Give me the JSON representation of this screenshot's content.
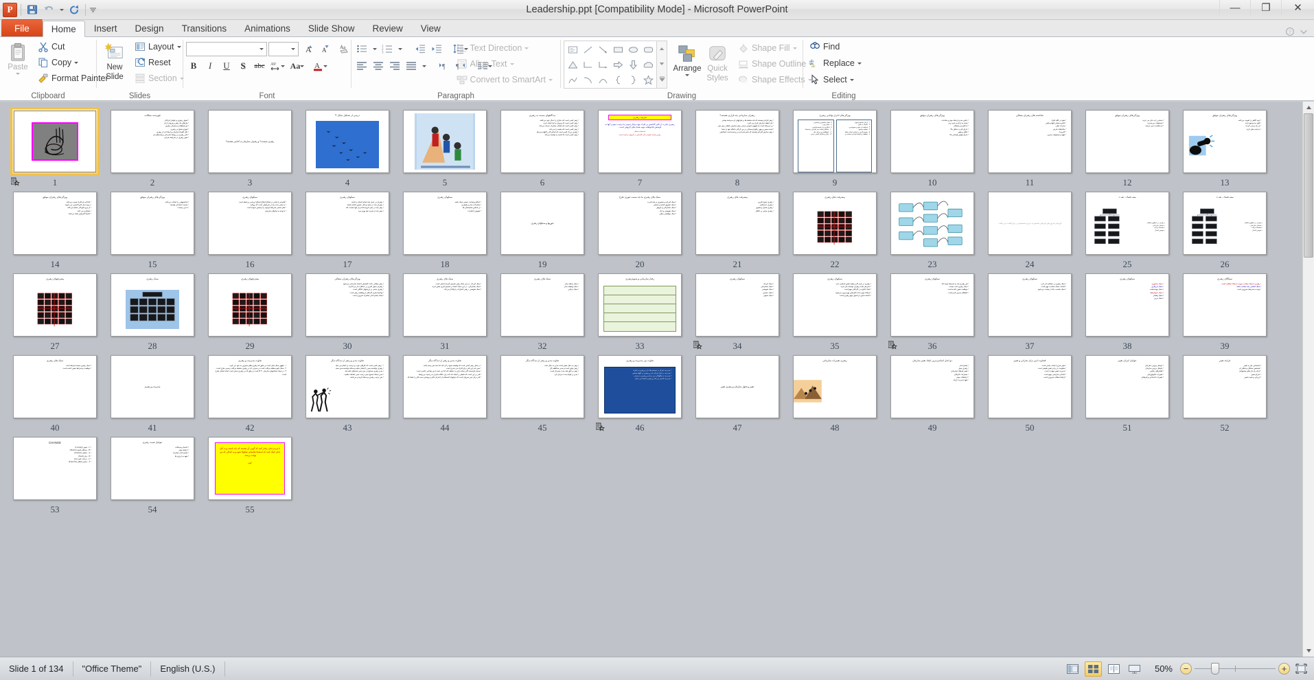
{
  "window": {
    "title": "Leadership.ppt [Compatibility Mode]  -  Microsoft PowerPoint",
    "minimize": "—",
    "restore": "❐",
    "close": "✕"
  },
  "qat": {
    "app_badge": "P",
    "items": [
      "save-icon",
      "undo-icon",
      "redo-icon",
      "customize-icon"
    ]
  },
  "tabs": [
    {
      "label": "File",
      "kind": "file"
    },
    {
      "label": "Home",
      "kind": "active"
    },
    {
      "label": "Insert",
      "kind": "normal"
    },
    {
      "label": "Design",
      "kind": "normal"
    },
    {
      "label": "Transitions",
      "kind": "normal"
    },
    {
      "label": "Animations",
      "kind": "normal"
    },
    {
      "label": "Slide Show",
      "kind": "normal"
    },
    {
      "label": "Review",
      "kind": "normal"
    },
    {
      "label": "View",
      "kind": "normal"
    }
  ],
  "ribbon": {
    "clipboard": {
      "label": "Clipboard",
      "paste": "Paste",
      "cut": "Cut",
      "copy": "Copy",
      "format_painter": "Format Painter"
    },
    "slides": {
      "label": "Slides",
      "new_slide": "New\nSlide",
      "new_slide_l1": "New",
      "new_slide_l2": "Slide",
      "layout": "Layout",
      "reset": "Reset",
      "section": "Section"
    },
    "font": {
      "label": "Font",
      "font_name": "",
      "font_size": "",
      "bold": "B",
      "italic": "I",
      "underline": "U",
      "shadow": "S",
      "strikethrough": "abc",
      "char_spacing": "AV",
      "change_case": "Aa",
      "font_color": "A",
      "grow_font": "A",
      "shrink_font": "A",
      "clear_formatting": "Aa"
    },
    "paragraph": {
      "label": "Paragraph",
      "text_direction": "Text Direction",
      "align_text": "Align Text",
      "convert_smartart": "Convert to SmartArt"
    },
    "drawing": {
      "label": "Drawing",
      "arrange": "Arrange",
      "quick_styles_l1": "Quick",
      "quick_styles_l2": "Styles",
      "shape_fill": "Shape Fill",
      "shape_outline": "Shape Outline",
      "shape_effects": "Shape Effects"
    },
    "editing": {
      "label": "Editing",
      "find": "Find",
      "replace": "Replace",
      "select": "Select"
    }
  },
  "status": {
    "slide_count": "Slide 1 of 134",
    "theme": "\"Office Theme\"",
    "language": "English (U.S.)",
    "zoom": "50%",
    "views": [
      {
        "name": "normal-view-button",
        "active": false
      },
      {
        "name": "slide-sorter-view-button",
        "active": true
      },
      {
        "name": "reading-view-button",
        "active": false
      },
      {
        "name": "slide-show-button",
        "active": false
      }
    ],
    "zoom_out": "−",
    "zoom_in": "+"
  },
  "slides": [
    {
      "n": "1",
      "type": "image-art",
      "selected": true,
      "anim": true,
      "title": "",
      "body": []
    },
    {
      "n": "2",
      "type": "bullets",
      "title": "فهرست مطالب",
      "body": [
        "اصول رهبری و عوامل اثرگذار",
        "نیازهای یک رهبر و پیروان از او",
        "تیم هماهنگ و سازمان رهبری",
        "بلوغ و تشنج در رهبری",
        "علل اقصاء سازمان و ارتقاء آن از رهبری",
        "تاثیر رهبری بر روابط سازمانی و پیامدهای آن",
        "تغییر رهبری در شرایط بحرانی"
      ]
    },
    {
      "n": "3",
      "type": "center",
      "title": "",
      "center": "رهبری چیست؟ و رهبران سازمان به کدامی هستند؟"
    },
    {
      "n": "4",
      "type": "image-birds",
      "title": "درسی از تشکیل شکل V",
      "body": []
    },
    {
      "n": "5",
      "type": "image-people",
      "title": "",
      "body": []
    },
    {
      "n": "6",
      "type": "bullets",
      "title": "دیدگاههای نسبت به رهبری",
      "body": [
        "رهبر کسی است که دیگران را دنبال خود می‌کشد",
        "رهبر کسی است که پیروان به او اعتماد دارند",
        "رهبر کسی است که باهدف مشترک حرکت می‌کند",
        "رهبر کسی است که مقصد را می‌داند",
        "رهبری بزرگ کسی است که انجام کار را الهام می‌دهد",
        "رهبر کسی است که افراد را توانمند می‌کند"
      ]
    },
    {
      "n": "7",
      "type": "definition",
      "title": "تعریف رهبری",
      "blue": "رهبری عبارت از تأثیر گذاشتن بر افراد جهت وادار نمودن یا ترغیب نمودن آنها به کوشش فاخواهانه جهت هدف های گروهی است .",
      "red_title": "باید هدف مدنظر",
      "red": "رهبری فرآیند کوشدر تأثیر گذاشتن بر گروهی از افراد است"
    },
    {
      "n": "8",
      "type": "bullets",
      "title": "رهبران سازمانی چه قراری هستند؟",
      "body": [
        "رهبر افرادی هستند که باید سلطه ها بر طرفهای آن سرشته پیشتر",
        "نیاز انعقاد سازمان قرار می گیرد .",
        "بر سرینکه است ما مفهوم عمومی آزسی رهبر سازش بامعادر زش نفی",
        "شده سپس و پنهن رافع آزسبجانی بر بین کركثر جایگاه عهد را بیاما",
        "رهبر سازش افرادی هستند که بایتر شده ای بر رسیده است اینجاتش"
      ]
    },
    {
      "n": "9",
      "type": "two-col",
      "title": "ویژگی‌های احراز توانایی رهبری",
      "col_right": [
        "۱ . آرمان صحیح و قوی :",
        "۲ . اعتماد به نفس :",
        "۳ . استفاده از نفوذ و حمونشری :",
        "۴ . تقطبید صحیح :",
        "۵ . تصمیم گیری بر اساس ایجاد رابطه",
        "۶ . تظاهیت و عامله افرادی سیاست و"
      ],
      "col_left": [
        "۷ . قصد تشخیص و پیشبینی :",
        "۸ . عمال بودن :",
        "۹ . ابتکاری و ارزشمندشناسی :",
        "۱۰ . نشاط و صمت سر افرادی پرشمشا :",
        "۱۱ . انعطافپذیری و بلند عیار",
        "۱۲ . شال و تشانلی کلشر برسی ."
      ]
    },
    {
      "n": "10",
      "type": "bullets",
      "title": "ویژگی‌های رهبران موفق",
      "body": [
        "دانش مند و ارتباط موثر و شناخت",
        "پایبند به اراده و عزم برتر",
        "با انگیزه و مشتاق",
        "دارای قدرت تحلیل بالا",
        "خلاق و نوآور",
        "دارای هوش هیجانی بالا"
      ]
    },
    {
      "n": "11",
      "type": "bullets",
      "title": "شاخصه های رهبران متعالی",
      "body": [
        "نفوذ در کلام افراد",
        "انگیزه بخشی الهام بخش",
        "محرک ذهنی",
        "ملاحظات فردی",
        "کاریزما",
        "تعهد و مسئولیت پذیری"
      ]
    },
    {
      "n": "12",
      "type": "bullets",
      "title": "ویژگی‌های رهبران موفق",
      "body": [
        "سختی را به جان می خرند",
        "مسئولیت می‌پذیرند",
        "از شکست نمی ترسند"
      ]
    },
    {
      "n": "13",
      "type": "image-binoc",
      "title": "ویژگی‌های رهبران موفق",
      "body": [
        "خود آگاهی را تقویت می‌کنند",
        "افق دید وسیع دارند",
        "از راه برنمی گردند",
        "به آینده نظر دارند"
      ]
    },
    {
      "n": "14",
      "type": "bullets",
      "title": "ویژگی‌های رهبران موفق",
      "body": [
        "عادلانه راه افراد نصیب می‌کنند",
        "زمینه ساز کاریا افزایی می شوند",
        "از نیرو مانع کار عملیه می‌کنند",
        "متفکری می کنند",
        "اعتماد افزایش ایجاد می‌کنند"
      ]
    },
    {
      "n": "15",
      "type": "bullets",
      "title": "ویژگی‌های رهبران موفق",
      "body": [
        "شاخصهایی را انتخاب می‌کنند",
        "محرك اجتماعی هستند",
        "با دین چیست"
      ]
    },
    {
      "n": "16",
      "type": "bullets",
      "title": "سبکهای رهبری",
      "body": [
        "قاصده را باشی در اصلاح اصلاح اصلاح ارزیابی و رابطه است",
        "به معنی بدنه راه در شرایطی است که رویکرد",
        "نظر سنجی شرایط موجود را آزمایش نموده است",
        "با توجه به نیازهای سازمان"
      ]
    },
    {
      "n": "17",
      "type": "bullets",
      "title": "سبکهای رهبری",
      "body": [
        "رهبران در عمل باید انجام اعمال را باشد",
        "رهبران باید در تمام مراحل حضور داشته باشند",
        "رهبر باید در میان گروه باشد و از آنها حمایت کند",
        "رهبر باید از تجربه خود بهره ببرد"
      ]
    },
    {
      "n": "18",
      "type": "bullets",
      "title": "سبکهای رهبری",
      "body": [
        "احکام و هدایت جمعی سبک باشد",
        "مشارکت مدار و همیاری",
        "بر اساس شایستگی ها",
        "تفویض اختیارات"
      ]
    },
    {
      "n": "19",
      "type": "center",
      "title": "",
      "center": "تئوریها و سبکهای رهبری"
    },
    {
      "n": "20",
      "type": "bullets",
      "title": "سبک های رهبری ما چه سمت تئوری طرح",
      "body": [
        "سبک آمرانه و دستوری بر پایه قدرت",
        "سبک تشویق کننده و حمایتی",
        "سبک مشارکتی و گروهی",
        "سبک تفویضی و آزاد",
        "سبک موقعیتی متغیر"
      ]
    },
    {
      "n": "21",
      "type": "bullets",
      "title": "پیشرفت های رهبری",
      "body": [
        "رهبری تحول آفرین",
        "رهبری خدمتگزار",
        "رهبری اصیل و معنوی",
        "رهبری مبتنی بر اخلاق"
      ]
    },
    {
      "n": "22",
      "type": "matrix-red",
      "title": "پیشرفت های رهبری",
      "body": []
    },
    {
      "n": "23",
      "type": "flow-diagram",
      "title": "",
      "body": []
    },
    {
      "n": "24",
      "type": "center-gray",
      "title": "",
      "center": "فروتنان امروز هم پذیرفتی تقسیم به عزیزه شستنیم در برابرگشت می باشد ."
    },
    {
      "n": "25",
      "type": "orgchart",
      "title": "پیشرفتهای رهبری",
      "body": []
    },
    {
      "n": "26",
      "type": "orgchart",
      "title": "پیشرفتهای رهبری",
      "body": []
    },
    {
      "n": "27",
      "type": "matrix-red2",
      "title": "پیشرفتهای رهبری",
      "body": []
    },
    {
      "n": "28",
      "type": "grid-dark",
      "title": "سبک رهبری",
      "body": []
    },
    {
      "n": "29",
      "type": "matrix-red3",
      "title": "پیشرفتهای رهبری",
      "body": []
    },
    {
      "n": "30",
      "type": "bullets",
      "title": "ویژگی‌های رهبران متعالی",
      "body": [
        "رهبر متعالی باعث افزایش اعتماد سازمانی می‌شود",
        "رهبران تحول آفرین بر عملکرد اثر می‌گذارند",
        "رهبری مبتنی بر ارزشهای اخلاقی است",
        "توانمندسازی کارکنان از وظایف رهبر است",
        "ایجاد چشم انداز مشترک ضروری است"
      ]
    },
    {
      "n": "31",
      "type": "bullets",
      "title": "سبک های رهبری",
      "body": [
        "سبک آمرانه ، در این سبک رهبر تصمیم گیرنده اصلی است",
        "سبک مشارکتی ، در این سبک اعضا در تصمیم گیری نقش دارند",
        "سبک تفویضی ، رهبر اختیارات را واگذار می‌کند"
      ]
    },
    {
      "n": "32",
      "type": "bullets",
      "title": "سبک های رهبری",
      "body": [
        "سبک رابطه مدار",
        "سبک وظیفه مدار",
        "سبک ترکیبی"
      ]
    },
    {
      "n": "33",
      "type": "green-table",
      "title": "رفتار سازمانی و شیوه‌رهبری",
      "body": []
    },
    {
      "n": "34",
      "type": "bullets",
      "anim": true,
      "title": "سبکهای رهبری",
      "body": [
        "سبک آمرانه",
        "سبک مشارکتی",
        "سبک تفویضی",
        "سبک حمایتی",
        "سبک تحولی"
      ]
    },
    {
      "n": "35",
      "type": "bullets",
      "title": "سبکهای رهبری",
      "body": [
        "رهبری در بازار کار و تولید نقش اساسی دارد",
        "سازمان ها به رهبران توانمند نیاز دارند",
        "ایجاد انگیزه در کارکنان مهم است",
        "ارتباط موثر باعث افزایش بهره وری می‌شود",
        "اعتماد سازی از اصول مهم رهبری است"
      ]
    },
    {
      "n": "36",
      "type": "bullets",
      "anim": true,
      "title": "سبکهای رهبری",
      "body": [
        "هر رهبری باید به شرایط توجه کند",
        "سبک رهبری ثابت نیست",
        "موقعیت تعیین کننده است",
        "انعطاف پذیری لازم است"
      ]
    },
    {
      "n": "37",
      "type": "bullets",
      "title": "سبکهای رهبری",
      "body": [
        "سبک رهبری بر عملکرد اثر دارد",
        "انتخاب سبک مناسب مهم است",
        "سبک مناسب باعث رضایت می‌شود"
      ]
    },
    {
      "n": "38",
      "type": "bullets-color",
      "title": "سبکهای رهبری",
      "body": [
        "سبک دستوری",
        "سبک مربیگری",
        "سبک پیونددهنده",
        "سبک دموکراتیک",
        "سبک پیشتاز",
        "سبک مربی"
      ]
    },
    {
      "n": "39",
      "type": "bullets-color",
      "title": "سبکگای رهبری",
      "body": [
        "رهبری با سبک مناسب موجب ارتقاء عملکرد است",
        "سبک انتخابی باید مناسب باشد",
        "توجه به شرایط ضروری است"
      ]
    },
    {
      "n": "40",
      "type": "bullets",
      "title": "سبک های رهبری",
      "body": [
        "سبک رهبری نتیجه شرایط است",
        "موقعیت و شرایط تعیین کننده است"
      ]
    },
    {
      "n": "41",
      "type": "center",
      "title": "",
      "center": "مدیریت و رهبری"
    },
    {
      "n": "42",
      "type": "bullets-num",
      "title": "تفاوت مدیریت و رهبری",
      "body": [
        "۱ . ظهور سبک مایل است بر طبق که رهبری ظلم محوری به خود می گیرد .",
        "۲ . سبک تاوم سلطه مراقب است در سیرتی که در رهبری سلطه مراقب رسمی طرح است .",
        "۳ . در سبک شعاعهای سازمان ۳۰ کا است بر طق که در رهبری سخن است اماته ایشان طرح است ."
      ]
    },
    {
      "n": "43",
      "type": "image-climb",
      "title": "تفاوت مدیر و رهبر از دیدگاه دیگر",
      "body": [
        "\" رهبر کسی است که کارهای خوب و درست را انجام می دهد و مدیر کسی است که کارها را به نحو انجام می دهد \"",
        "رهبری توانسته سیر را انتشار دهده و سبکه توانسته سیر صحیح را درست طی می‌کند",
        "مدیر رهبری صحیح در متن سیر دشدهای غلبه شد",
        "مدیر سبکه صحیح سیر درست سیر حفاظت طلبید .",
        "متن ترتیب رهبری و سبکه اثرپذیر می‌باشد"
      ]
    },
    {
      "n": "44",
      "type": "bullets",
      "title": "تفاوت مدیر و رهبر از دیدگاه دیگر",
      "body": [
        "در اصل رهبر کسی است که وظیفه سبود را آن کند که ستد شن پسه باشد",
        "نمین امر این قدر برای افراد می بحری است",
        "بسیار فرایسته کادر سبانه بازی را حفظه کند که این جنبه با بین توانایی خاصی است",
        "قدر بر این است که تحلیلی را ایجاد کند که دران علاقه سازان به رجمیت و روابط",
        "قدر برای حین سروان است که جوانها با استفاده از احترام عالی و روشنی سبد دقل را حفظ که لقد فراقنی مسانورا کند"
      ]
    },
    {
      "n": "45",
      "type": "bullets",
      "title": "تفاوت مدیر و رهبر از دیدگاه دیگر",
      "body": [
        "رهبر به دنبال تغییر است مدیر به دنبال ثبات",
        "رهبر نوآور است و مدیر محافظه کار",
        "رهبر بر افق بلند مدت متمرکز است",
        "مدیر بر کوتاه مدت تمرکز دارد"
      ]
    },
    {
      "n": "46",
      "type": "blue-box",
      "anim": true,
      "title": "تفاوت بین مدیریت و رهبری",
      "body": [
        "مدیریت تمرکز بر سیستم ها دارد و رهبری بر افراد",
        "مدیریت بر اجرا تمرکز دارد و رهبری بر الهام بخشی",
        "مدیریت به چگونگی می پردازد و رهبری به چرایی",
        "مدیریت کنترل می کند و رهبری اعتماد می سازد"
      ]
    },
    {
      "n": "47",
      "type": "center",
      "title": "",
      "center": "تغییر و تحول سازمان و رهبری تغییر"
    },
    {
      "n": "48",
      "type": "image-mountain",
      "title": "رهبری تغییرات سازمانی",
      "body": []
    },
    {
      "n": "49",
      "type": "bullets",
      "title": "دو اصل اساسی‌ترین ایجاد تغییر سازمان",
      "body": [
        "چشم انداز",
        "رهبری موثر",
        "تغییر فرهنگ سازمانی",
        "مشارکت کارکنان",
        "ارتباطات موثر",
        "تعهد مدیریت ارشد"
      ]
    },
    {
      "n": "50",
      "type": "bullets",
      "title": "قضاوت آیین برای بحرانی و تغییر",
      "body": [
        "تغییر امری اجتناب ناپذیر است",
        "مقاومت در برابر تغییر طبیعی است",
        "مدیریت تغییر مهارت است",
        "آمادگی سازمانی مهم است",
        "ارتباط شفاف ضروری است"
      ]
    },
    {
      "n": "51",
      "type": "bullets",
      "title": "عوامل امرای تغییر",
      "body": [
        "عوامل بیرونی سازمان",
        "عوامل درونی سازمان",
        "فشارهای رقابتی",
        "تغییرات تکنولوژیکی",
        "تغییرات اجتماعی و فرهنگی"
      ]
    },
    {
      "n": "52",
      "type": "bullets",
      "title": "فرآیند تغییر",
      "body": [
        "شناسایی نیاز به تغییر",
        "تشخیص مشکل و تحلیل آن",
        "ارائه راه حل های پیشنهادی",
        "اجرای تغییر",
        "ارزیابی و تثبیت تغییر"
      ]
    },
    {
      "n": "53",
      "type": "change",
      "title": "CHANGE",
      "body": [
        "C – تغییر (Courage)",
        "H – صادقه باشید (Honest)",
        "A – تحلیل (Analyze)",
        "N – نیاز (Need)",
        "G – حرکت کنید (Go)",
        "E – مسیر انتظار (Expected)"
      ]
    },
    {
      "n": "54",
      "type": "bullets",
      "title": "عوامل تثبیت رهبری",
      "body": [
        "اعتماد و صداقت",
        "ارتباط موثر",
        "چشم انداز مشترک",
        "تعهد به ارزش ها"
      ]
    },
    {
      "n": "55",
      "type": "yellow-final",
      "title": "",
      "yellow_text": "با مردم چنان رفتار کنید که گویی آن هستند که باید باشند و به آنان چنان کمک کنید که استعدادهایشان شکوفا شود و به کمالی که می توانند برسند .",
      "yellow_sign": "گوته"
    }
  ]
}
